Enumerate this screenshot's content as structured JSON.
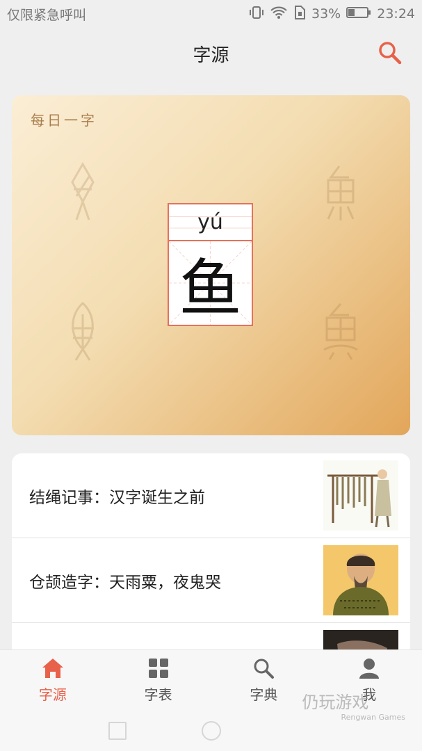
{
  "status_bar": {
    "carrier": "仅限紧急呼叫",
    "battery": "33%",
    "time": "23:24"
  },
  "header": {
    "title": "字源"
  },
  "daily_char": {
    "label": "每日一字",
    "pinyin": "yú",
    "character": "鱼"
  },
  "articles": [
    {
      "title": "结绳记事：汉字诞生之前",
      "thumb": "knot-record-illustration"
    },
    {
      "title": "仓颉造字：天雨粟，夜鬼哭",
      "thumb": "cangjie-portrait"
    }
  ],
  "tabs": [
    {
      "label": "字源",
      "icon": "home-icon",
      "active": true
    },
    {
      "label": "字表",
      "icon": "grid-icon",
      "active": false
    },
    {
      "label": "字典",
      "icon": "search-icon",
      "active": false
    },
    {
      "label": "我",
      "icon": "person-icon",
      "active": false
    }
  ],
  "watermark": {
    "main": "仍玩游戏",
    "sub": "Rengwan Games"
  },
  "colors": {
    "accent": "#e8614a",
    "card_gradient_start": "#fbeed6",
    "card_gradient_end": "#e2a65a"
  }
}
